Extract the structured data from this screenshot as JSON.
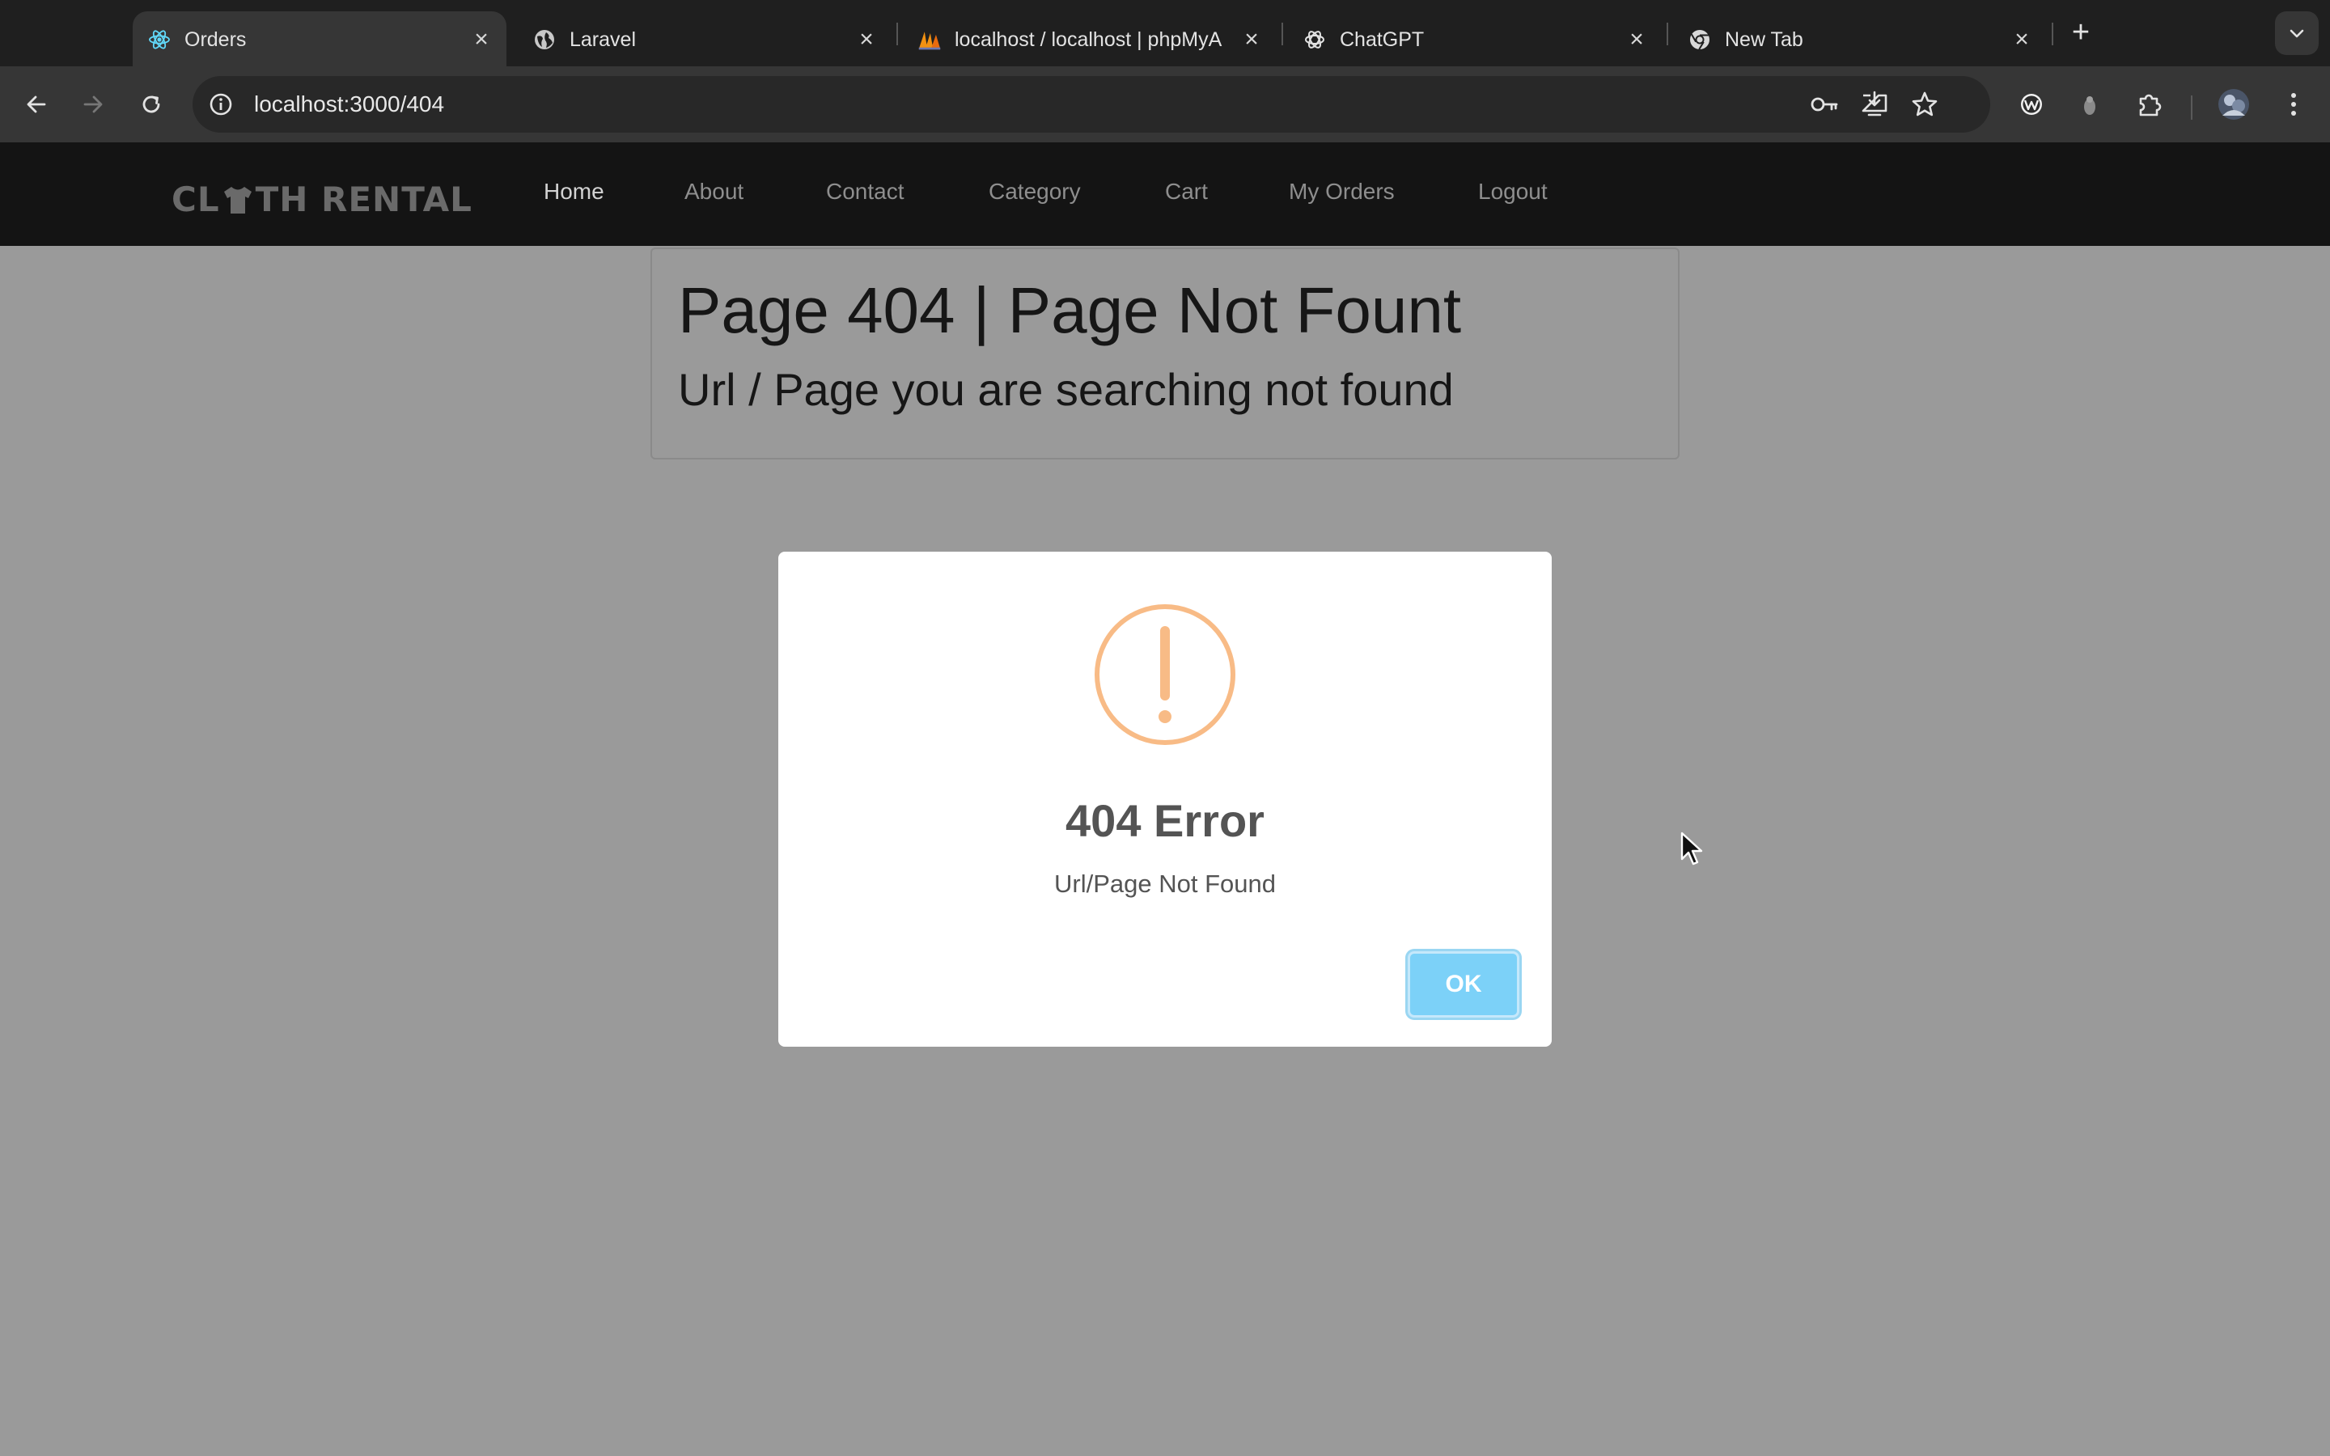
{
  "browser": {
    "tabs": [
      {
        "title": "Orders",
        "icon": "react-icon",
        "active": true
      },
      {
        "title": "Laravel",
        "icon": "globe-icon",
        "active": false
      },
      {
        "title": "localhost / localhost | phpMyA",
        "icon": "phpmyadmin-icon",
        "active": false
      },
      {
        "title": "ChatGPT",
        "icon": "chatgpt-icon",
        "active": false
      },
      {
        "title": "New Tab",
        "icon": "chrome-icon",
        "active": false
      }
    ],
    "new_tab_symbol": "+",
    "url": "localhost:3000/404"
  },
  "app": {
    "brand": {
      "left": "CL",
      "right": "TH RENTAL"
    },
    "nav": {
      "home": "Home",
      "about": "About",
      "contact": "Contact",
      "category": "Category",
      "cart": "Cart",
      "my_orders": "My Orders",
      "logout": "Logout"
    },
    "notfound": {
      "title": "Page 404 | Page Not Fount",
      "subtitle": "Url / Page you are searching not found"
    }
  },
  "modal": {
    "icon": "warning-icon",
    "title": "404 Error",
    "text": "Url/Page Not Found",
    "ok_label": "OK",
    "accent_color": "#f8bb86",
    "button_color": "#7cd1f8"
  },
  "colors": {
    "overlay": "#9a9a9a",
    "navbar": "#141414"
  }
}
